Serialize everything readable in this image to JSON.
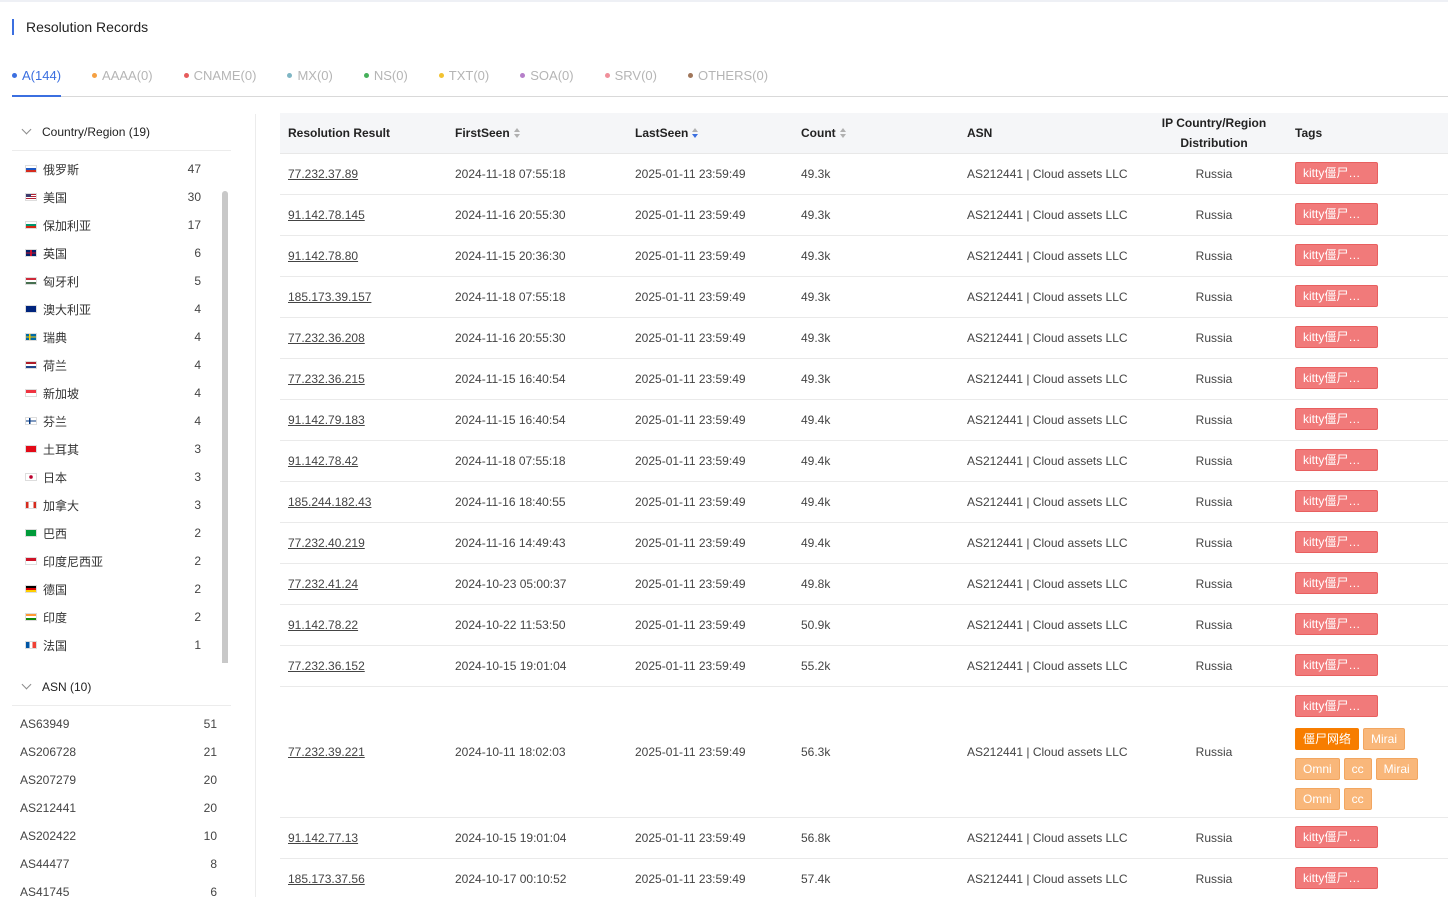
{
  "title": "Resolution Records",
  "tabs": [
    {
      "label": "A(144)",
      "color": "#3b6fe0",
      "active": true
    },
    {
      "label": "AAAA(0)",
      "color": "#f5a042"
    },
    {
      "label": "CNAME(0)",
      "color": "#e65c5c"
    },
    {
      "label": "MX(0)",
      "color": "#7fb6c4"
    },
    {
      "label": "NS(0)",
      "color": "#45b05a"
    },
    {
      "label": "TXT(0)",
      "color": "#f2c230"
    },
    {
      "label": "SOA(0)",
      "color": "#b57fc9"
    },
    {
      "label": "SRV(0)",
      "color": "#f08f9a"
    },
    {
      "label": "OTHERS(0)",
      "color": "#a0765a"
    }
  ],
  "sidebar": {
    "country_header": "Country/Region (19)",
    "countries": [
      {
        "name": "俄罗斯",
        "count": "47",
        "flag": "ru"
      },
      {
        "name": "美国",
        "count": "30",
        "flag": "us"
      },
      {
        "name": "保加利亚",
        "count": "17",
        "flag": "bg"
      },
      {
        "name": "英国",
        "count": "6",
        "flag": "gb"
      },
      {
        "name": "匈牙利",
        "count": "5",
        "flag": "hu"
      },
      {
        "name": "澳大利亚",
        "count": "4",
        "flag": "au"
      },
      {
        "name": "瑞典",
        "count": "4",
        "flag": "se"
      },
      {
        "name": "荷兰",
        "count": "4",
        "flag": "nl"
      },
      {
        "name": "新加坡",
        "count": "4",
        "flag": "sg"
      },
      {
        "name": "芬兰",
        "count": "4",
        "flag": "fi"
      },
      {
        "name": "土耳其",
        "count": "3",
        "flag": "tr"
      },
      {
        "name": "日本",
        "count": "3",
        "flag": "jp"
      },
      {
        "name": "加拿大",
        "count": "3",
        "flag": "ca"
      },
      {
        "name": "巴西",
        "count": "2",
        "flag": "br"
      },
      {
        "name": "印度尼西亚",
        "count": "2",
        "flag": "id"
      },
      {
        "name": "德国",
        "count": "2",
        "flag": "de"
      },
      {
        "name": "印度",
        "count": "2",
        "flag": "in"
      },
      {
        "name": "法国",
        "count": "1",
        "flag": "fr"
      }
    ],
    "asn_header": "ASN (10)",
    "asns": [
      {
        "name": "AS63949",
        "count": "51"
      },
      {
        "name": "AS206728",
        "count": "21"
      },
      {
        "name": "AS207279",
        "count": "20"
      },
      {
        "name": "AS212441",
        "count": "20"
      },
      {
        "name": "AS202422",
        "count": "10"
      },
      {
        "name": "AS44477",
        "count": "8"
      },
      {
        "name": "AS41745",
        "count": "6"
      }
    ]
  },
  "table": {
    "headers": {
      "result": "Resolution Result",
      "first_seen": "FirstSeen",
      "last_seen": "LastSeen",
      "count": "Count",
      "asn": "ASN",
      "distribution": "IP Country/Region Distribution",
      "tags": "Tags"
    },
    "rows": [
      {
        "ip": "77.232.37.89",
        "first": "2024-11-18 07:55:18",
        "last": "2025-01-11 23:59:49",
        "count": "49.3k",
        "asn": "AS212441 | Cloud assets LLC",
        "region": "Russia",
        "tags": [
          {
            "text": "kitty僵尸…",
            "style": "red"
          }
        ]
      },
      {
        "ip": "91.142.78.145",
        "first": "2024-11-16 20:55:30",
        "last": "2025-01-11 23:59:49",
        "count": "49.3k",
        "asn": "AS212441 | Cloud assets LLC",
        "region": "Russia",
        "tags": [
          {
            "text": "kitty僵尸…",
            "style": "red"
          }
        ]
      },
      {
        "ip": "91.142.78.80",
        "first": "2024-11-15 20:36:30",
        "last": "2025-01-11 23:59:49",
        "count": "49.3k",
        "asn": "AS212441 | Cloud assets LLC",
        "region": "Russia",
        "tags": [
          {
            "text": "kitty僵尸…",
            "style": "red"
          }
        ]
      },
      {
        "ip": "185.173.39.157",
        "first": "2024-11-18 07:55:18",
        "last": "2025-01-11 23:59:49",
        "count": "49.3k",
        "asn": "AS212441 | Cloud assets LLC",
        "region": "Russia",
        "tags": [
          {
            "text": "kitty僵尸…",
            "style": "red"
          }
        ]
      },
      {
        "ip": "77.232.36.208",
        "first": "2024-11-16 20:55:30",
        "last": "2025-01-11 23:59:49",
        "count": "49.3k",
        "asn": "AS212441 | Cloud assets LLC",
        "region": "Russia",
        "tags": [
          {
            "text": "kitty僵尸…",
            "style": "red"
          }
        ]
      },
      {
        "ip": "77.232.36.215",
        "first": "2024-11-15 16:40:54",
        "last": "2025-01-11 23:59:49",
        "count": "49.3k",
        "asn": "AS212441 | Cloud assets LLC",
        "region": "Russia",
        "tags": [
          {
            "text": "kitty僵尸…",
            "style": "red"
          }
        ]
      },
      {
        "ip": "91.142.79.183",
        "first": "2024-11-15 16:40:54",
        "last": "2025-01-11 23:59:49",
        "count": "49.4k",
        "asn": "AS212441 | Cloud assets LLC",
        "region": "Russia",
        "tags": [
          {
            "text": "kitty僵尸…",
            "style": "red"
          }
        ]
      },
      {
        "ip": "91.142.78.42",
        "first": "2024-11-18 07:55:18",
        "last": "2025-01-11 23:59:49",
        "count": "49.4k",
        "asn": "AS212441 | Cloud assets LLC",
        "region": "Russia",
        "tags": [
          {
            "text": "kitty僵尸…",
            "style": "red"
          }
        ]
      },
      {
        "ip": "185.244.182.43",
        "first": "2024-11-16 18:40:55",
        "last": "2025-01-11 23:59:49",
        "count": "49.4k",
        "asn": "AS212441 | Cloud assets LLC",
        "region": "Russia",
        "tags": [
          {
            "text": "kitty僵尸…",
            "style": "red"
          }
        ]
      },
      {
        "ip": "77.232.40.219",
        "first": "2024-11-16 14:49:43",
        "last": "2025-01-11 23:59:49",
        "count": "49.4k",
        "asn": "AS212441 | Cloud assets LLC",
        "region": "Russia",
        "tags": [
          {
            "text": "kitty僵尸…",
            "style": "red"
          }
        ]
      },
      {
        "ip": "77.232.41.24",
        "first": "2024-10-23 05:00:37",
        "last": "2025-01-11 23:59:49",
        "count": "49.8k",
        "asn": "AS212441 | Cloud assets LLC",
        "region": "Russia",
        "tags": [
          {
            "text": "kitty僵尸…",
            "style": "red"
          }
        ]
      },
      {
        "ip": "91.142.78.22",
        "first": "2024-10-22 11:53:50",
        "last": "2025-01-11 23:59:49",
        "count": "50.9k",
        "asn": "AS212441 | Cloud assets LLC",
        "region": "Russia",
        "tags": [
          {
            "text": "kitty僵尸…",
            "style": "red"
          }
        ]
      },
      {
        "ip": "77.232.36.152",
        "first": "2024-10-15 19:01:04",
        "last": "2025-01-11 23:59:49",
        "count": "55.2k",
        "asn": "AS212441 | Cloud assets LLC",
        "region": "Russia",
        "tags": [
          {
            "text": "kitty僵尸…",
            "style": "red"
          }
        ]
      },
      {
        "ip": "77.232.39.221",
        "first": "2024-10-11 18:02:03",
        "last": "2025-01-11 23:59:49",
        "count": "56.3k",
        "asn": "AS212441 | Cloud assets LLC",
        "region": "Russia",
        "tall": true,
        "tags": [
          {
            "text": "kitty僵尸…",
            "style": "red"
          },
          {
            "text": "僵尸网络",
            "style": "orange"
          },
          {
            "text": "Mirai",
            "style": "light"
          },
          {
            "text": "Omni",
            "style": "light"
          },
          {
            "text": "cc",
            "style": "light"
          },
          {
            "text": "Mirai",
            "style": "light"
          },
          {
            "text": "Omni",
            "style": "light"
          },
          {
            "text": "cc",
            "style": "light"
          }
        ]
      },
      {
        "ip": "91.142.77.13",
        "first": "2024-10-15 19:01:04",
        "last": "2025-01-11 23:59:49",
        "count": "56.8k",
        "asn": "AS212441 | Cloud assets LLC",
        "region": "Russia",
        "tags": [
          {
            "text": "kitty僵尸…",
            "style": "red"
          }
        ]
      },
      {
        "ip": "185.173.37.56",
        "first": "2024-10-17 00:10:52",
        "last": "2025-01-11 23:59:49",
        "count": "57.4k",
        "asn": "AS212441 | Cloud assets LLC",
        "region": "Russia",
        "tags": [
          {
            "text": "kitty僵尸…",
            "style": "red"
          }
        ]
      }
    ]
  }
}
